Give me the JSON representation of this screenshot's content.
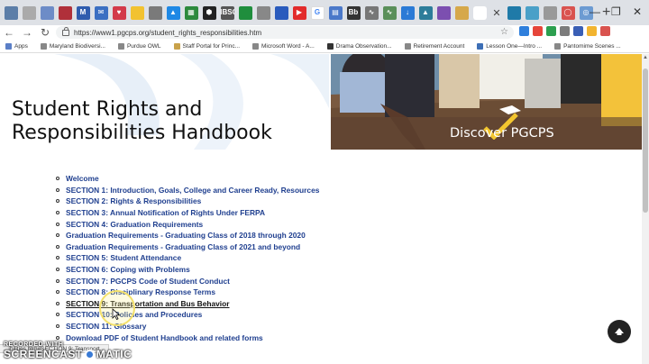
{
  "browser": {
    "tabs": [
      {
        "icon": "shield-icon",
        "color": "#5c7ea8",
        "glyph": ""
      },
      {
        "icon": "app-icon",
        "color": "#aaaaaa",
        "glyph": ""
      },
      {
        "icon": "edit-icon",
        "color": "#6d8cc7",
        "glyph": ""
      },
      {
        "icon": "shield-red-icon",
        "color": "#b0303a",
        "glyph": ""
      },
      {
        "icon": "news-icon",
        "color": "#2f5cae",
        "glyph": "M"
      },
      {
        "icon": "mail-icon",
        "color": "#3b6fc2",
        "glyph": "✉"
      },
      {
        "icon": "heart-icon",
        "color": "#d33a4a",
        "glyph": "♥"
      },
      {
        "icon": "folder-icon",
        "color": "#f2c230",
        "glyph": ""
      },
      {
        "icon": "document-icon",
        "color": "#7a7a7a",
        "glyph": ""
      },
      {
        "icon": "drive-icon",
        "color": "#1e88e5",
        "glyph": "▲"
      },
      {
        "icon": "mosaic-icon",
        "color": "#2d8a3d",
        "glyph": "▦"
      },
      {
        "icon": "hex-icon",
        "color": "#222222",
        "glyph": "⬢"
      },
      {
        "icon": "ebsco-icon",
        "color": "#555555",
        "glyph": "HBSC"
      },
      {
        "icon": "sheets-icon",
        "color": "#1f8e3d",
        "glyph": ""
      },
      {
        "icon": "clipboard-icon",
        "color": "#888888",
        "glyph": ""
      },
      {
        "icon": "bookmark-icon",
        "color": "#2a5bbd",
        "glyph": ""
      },
      {
        "icon": "youtube-icon",
        "color": "#e22b2b",
        "glyph": "▶"
      },
      {
        "icon": "google-icon",
        "color": "#ffffff",
        "glyph": "G"
      },
      {
        "icon": "grid-icon",
        "color": "#4a78c9",
        "glyph": "▤"
      },
      {
        "icon": "bb-icon",
        "color": "#333333",
        "glyph": "Bb"
      },
      {
        "icon": "wave-icon",
        "color": "#777777",
        "glyph": "∿"
      },
      {
        "icon": "pulse-icon",
        "color": "#5a8f5a",
        "glyph": "∿"
      },
      {
        "icon": "download-icon",
        "color": "#2a7ad6",
        "glyph": "↓"
      },
      {
        "icon": "triangle-icon",
        "color": "#2d7d9a",
        "glyph": "▲"
      },
      {
        "icon": "pencil-icon",
        "color": "#7c4fb0",
        "glyph": ""
      },
      {
        "icon": "page-icon",
        "color": "#d6a84a",
        "glyph": ""
      },
      {
        "icon": "active-tab-icon",
        "color": "#1d5a9e",
        "glyph": ""
      },
      {
        "icon": "close-tab-icon",
        "color": "#444444",
        "glyph": "✕"
      },
      {
        "icon": "square-icon",
        "color": "#1f7aa8",
        "glyph": ""
      },
      {
        "icon": "user-icon",
        "color": "#4aa0c8",
        "glyph": ""
      },
      {
        "icon": "image-icon",
        "color": "#999999",
        "glyph": ""
      },
      {
        "icon": "ring-icon",
        "color": "#d9534f",
        "glyph": "◯"
      },
      {
        "icon": "globe-icon",
        "color": "#6c9bd2",
        "glyph": "◎"
      }
    ],
    "url": "https://www1.pgcps.org/student_rights_responsibilities.htm",
    "bookmarks": [
      {
        "label": "Apps",
        "icon": "apps-icon",
        "color": "#5b7fc7"
      },
      {
        "label": "Maryland Biodiversi...",
        "icon": "document-icon",
        "color": "#888888"
      },
      {
        "label": "Purdue OWL",
        "icon": "document-icon",
        "color": "#888888"
      },
      {
        "label": "Staff Portal for Princ...",
        "icon": "portal-icon",
        "color": "#c9a24a"
      },
      {
        "label": "Microsoft Word - A...",
        "icon": "document-icon",
        "color": "#888888"
      },
      {
        "label": "Drama Observation...",
        "icon": "bb-icon",
        "color": "#333333"
      },
      {
        "label": "Retirement Account",
        "icon": "document-icon",
        "color": "#888888"
      },
      {
        "label": "Lesson One—Intro ...",
        "icon": "lesson-icon",
        "color": "#3d6fb6"
      },
      {
        "label": "Pantomime Scenes ...",
        "icon": "document-icon",
        "color": "#888888"
      }
    ],
    "bookmark_apps_prefix": "",
    "extensions": [
      "#2f7fdc",
      "#e6453a",
      "#2c9f4f",
      "#7c7c7c",
      "#3a5fb5",
      "#f2b430",
      "#d9534f"
    ]
  },
  "banner": {
    "title_line1": "Student Rights and",
    "title_line2": "Responsibilities Handbook",
    "discover": "Discover PGCPS"
  },
  "toc": [
    {
      "label": "Welcome"
    },
    {
      "label": "SECTION 1: Introduction, Goals, College and Career Ready, Resources"
    },
    {
      "label": "SECTION 2: Rights & Responsibilities"
    },
    {
      "label": "SECTION 3: Annual Notification of Rights Under FERPA"
    },
    {
      "label": "SECTION 4: Graduation Requirements"
    },
    {
      "label": "Graduation Requirements - Graduating Class of 2018 through 2020"
    },
    {
      "label": "Graduation Requirements - Graduating Class of 2021 and beyond"
    },
    {
      "label": "SECTION 5: Student Attendance"
    },
    {
      "label": "SECTION 6: Coping with Problems"
    },
    {
      "label": "SECTION 7: PGCPS Code of Student Conduct"
    },
    {
      "label": "SECTION 8: Disciplinary Response Terms"
    },
    {
      "label": "SECTION 9: Transportation and Bus Behavior",
      "hover": true
    },
    {
      "label": "SECTION 10: Policies and Procedures"
    },
    {
      "label": "SECTION 11: Glossary"
    },
    {
      "label": "Download PDF of Student Handbook and related forms"
    }
  ],
  "status_url": "...ibilities.htm#SECTION 9: Transport...",
  "watermark": {
    "top": "RECORDED WITH",
    "bottom_left": "SCREENCAST",
    "bottom_right": "MATIC"
  }
}
